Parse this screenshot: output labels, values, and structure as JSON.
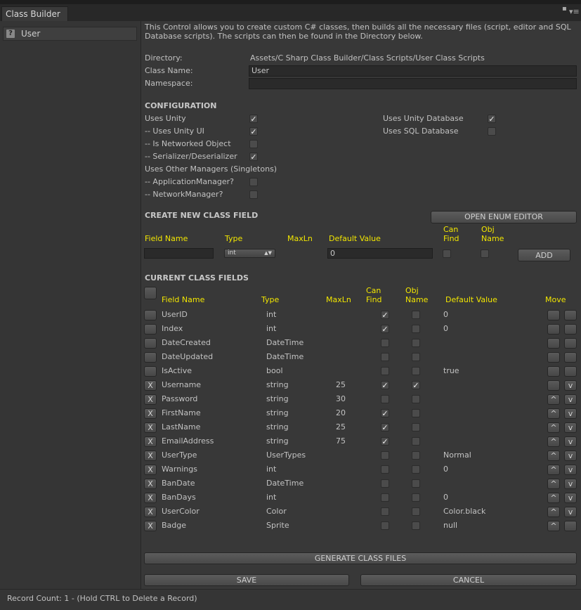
{
  "window": {
    "tab_title": "Class Builder",
    "list_items": [
      "User"
    ]
  },
  "description": "This Control allows you to create custom C# classes, then builds all the necessary files (script, editor and SQL Database scripts). The scripts can then be found in the Directory below.",
  "directory": {
    "label": "Directory:",
    "value": "Assets/C Sharp Class Builder/Class Scripts/User Class Scripts"
  },
  "class_name": {
    "label": "Class Name:",
    "value": "User"
  },
  "namespace": {
    "label": "Namespace:",
    "value": ""
  },
  "configuration": {
    "title": "CONFIGURATION",
    "left": [
      {
        "label": "Uses Unity",
        "checked": true
      },
      {
        "label": "-- Uses Unity UI",
        "checked": true
      },
      {
        "label": "-- Is Networked Object",
        "checked": false
      },
      {
        "label": "-- Serializer/Deserializer",
        "checked": true
      },
      {
        "label": "Uses Other Managers (Singletons)",
        "checked": null
      },
      {
        "label": "-- ApplicationManager?",
        "checked": false
      },
      {
        "label": "-- NetworkManager?",
        "checked": false
      }
    ],
    "right": [
      {
        "label": "Uses Unity Database",
        "checked": true
      },
      {
        "label": "Uses SQL Database",
        "checked": false
      }
    ]
  },
  "create_field": {
    "title": "CREATE NEW CLASS FIELD",
    "open_enum_label": "OPEN ENUM EDITOR",
    "headers": {
      "field_name": "Field Name",
      "type": "Type",
      "maxln": "MaxLn",
      "default_value": "Default Value",
      "can_find": "Can\nFind",
      "obj_name": "Obj\nName"
    },
    "field_name_value": "",
    "type_value": "int",
    "default_value": "0",
    "add_label": "ADD"
  },
  "current_fields": {
    "title": "CURRENT CLASS FIELDS",
    "headers": {
      "field_name": "Field Name",
      "type": "Type",
      "maxln": "MaxLn",
      "can_find": "Can\nFind",
      "obj_name": "Obj\nName",
      "default_value": "Default Value",
      "move": "Move"
    },
    "rows": [
      {
        "name": "UserID",
        "type": "int",
        "maxln": "",
        "can_find": true,
        "obj_name": false,
        "default": "0",
        "deletable": false,
        "up": false,
        "down": false
      },
      {
        "name": "Index",
        "type": "int",
        "maxln": "",
        "can_find": true,
        "obj_name": false,
        "default": "0",
        "deletable": false,
        "up": false,
        "down": false
      },
      {
        "name": "DateCreated",
        "type": "DateTime",
        "maxln": "",
        "can_find": false,
        "obj_name": false,
        "default": "",
        "deletable": false,
        "up": false,
        "down": false
      },
      {
        "name": "DateUpdated",
        "type": "DateTime",
        "maxln": "",
        "can_find": false,
        "obj_name": false,
        "default": "",
        "deletable": false,
        "up": false,
        "down": false
      },
      {
        "name": "IsActive",
        "type": "bool",
        "maxln": "",
        "can_find": false,
        "obj_name": false,
        "default": "true",
        "deletable": false,
        "up": false,
        "down": false
      },
      {
        "name": "Username",
        "type": "string",
        "maxln": "25",
        "can_find": true,
        "obj_name": true,
        "default": "",
        "deletable": true,
        "up": false,
        "down": true
      },
      {
        "name": "Password",
        "type": "string",
        "maxln": "30",
        "can_find": false,
        "obj_name": false,
        "default": "",
        "deletable": true,
        "up": true,
        "down": true
      },
      {
        "name": "FirstName",
        "type": "string",
        "maxln": "20",
        "can_find": true,
        "obj_name": false,
        "default": "",
        "deletable": true,
        "up": true,
        "down": true
      },
      {
        "name": "LastName",
        "type": "string",
        "maxln": "25",
        "can_find": true,
        "obj_name": false,
        "default": "",
        "deletable": true,
        "up": true,
        "down": true
      },
      {
        "name": "EmailAddress",
        "type": "string",
        "maxln": "75",
        "can_find": true,
        "obj_name": false,
        "default": "",
        "deletable": true,
        "up": true,
        "down": true
      },
      {
        "name": "UserType",
        "type": "UserTypes",
        "maxln": "",
        "can_find": false,
        "obj_name": false,
        "default": "Normal",
        "deletable": true,
        "up": true,
        "down": true
      },
      {
        "name": "Warnings",
        "type": "int",
        "maxln": "",
        "can_find": false,
        "obj_name": false,
        "default": "0",
        "deletable": true,
        "up": true,
        "down": true
      },
      {
        "name": "BanDate",
        "type": "DateTime",
        "maxln": "",
        "can_find": false,
        "obj_name": false,
        "default": "",
        "deletable": true,
        "up": true,
        "down": true
      },
      {
        "name": "BanDays",
        "type": "int",
        "maxln": "",
        "can_find": false,
        "obj_name": false,
        "default": "0",
        "deletable": true,
        "up": true,
        "down": true
      },
      {
        "name": "UserColor",
        "type": "Color",
        "maxln": "",
        "can_find": false,
        "obj_name": false,
        "default": "Color.black",
        "deletable": true,
        "up": true,
        "down": true
      },
      {
        "name": "Badge",
        "type": "Sprite",
        "maxln": "",
        "can_find": false,
        "obj_name": false,
        "default": "null",
        "deletable": true,
        "up": true,
        "down": false
      }
    ]
  },
  "buttons": {
    "generate": "GENERATE CLASS FILES",
    "save": "SAVE",
    "cancel": "CANCEL"
  },
  "status": "Record Count: 1 - (Hold CTRL to Delete a Record)",
  "colors": {
    "accent_yellow": "#f2e600",
    "panel": "#383838"
  }
}
